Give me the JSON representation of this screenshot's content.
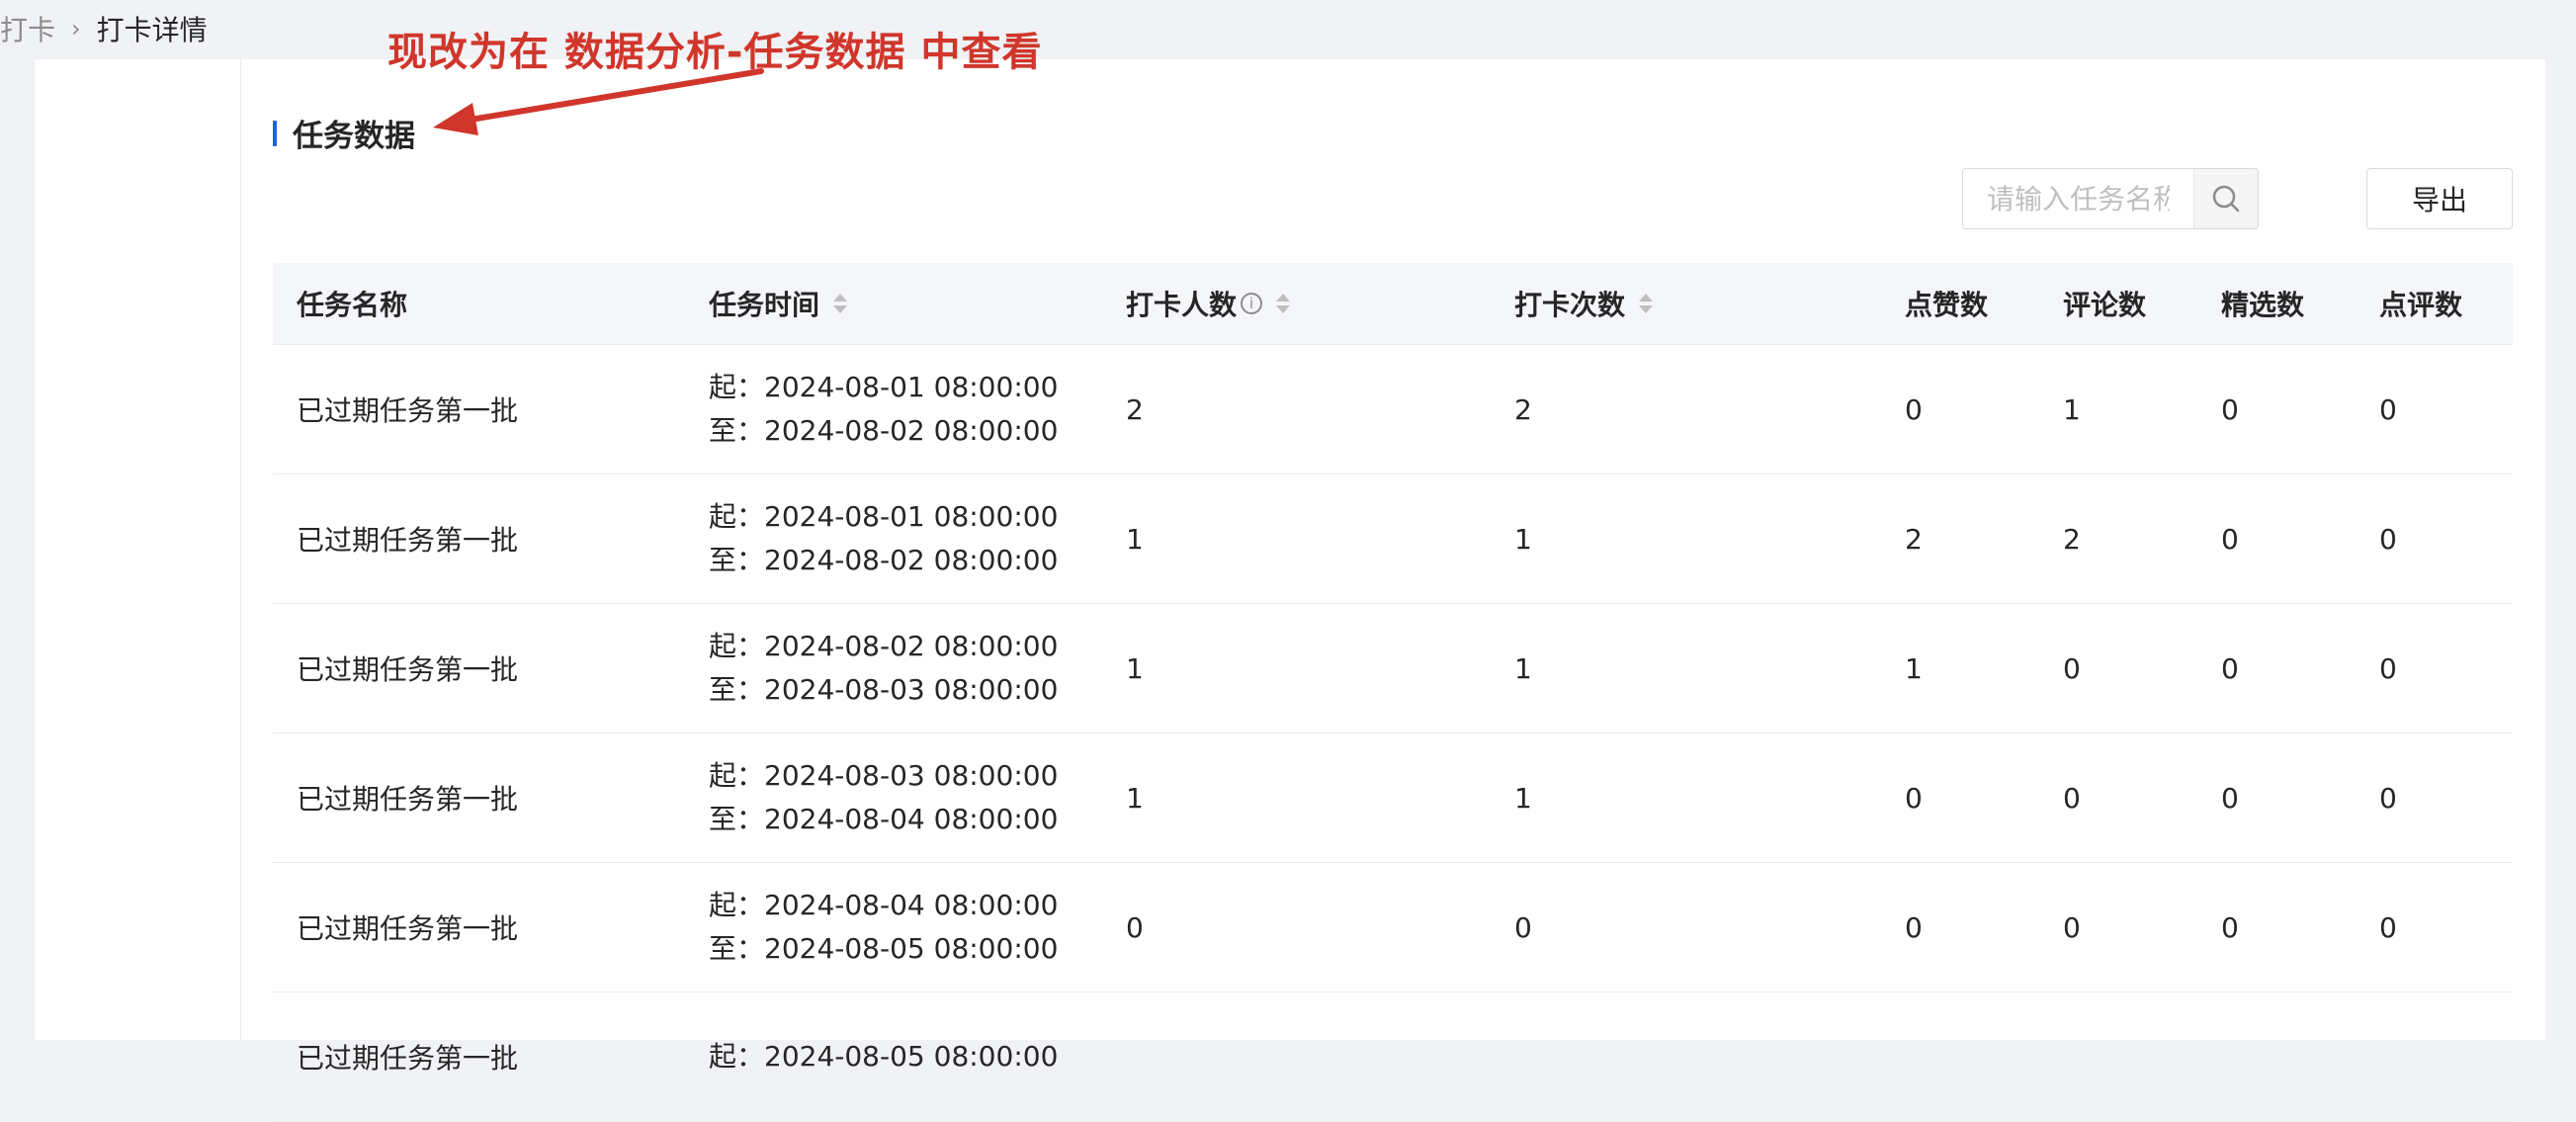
{
  "breadcrumb": {
    "items": [
      "打卡"
    ],
    "current": "打卡详情"
  },
  "annotation": {
    "text": "现改为在 数据分析-任务数据 中查看"
  },
  "section": {
    "title": "任务数据"
  },
  "search": {
    "placeholder": "请输入任务名称",
    "value": ""
  },
  "toolbar": {
    "export_label": "导出"
  },
  "table": {
    "headers": [
      "任务名称",
      "任务时间",
      "打卡人数",
      "打卡次数",
      "点赞数",
      "评论数",
      "精选数",
      "点评数"
    ],
    "rows": [
      {
        "name": "已过期任务第一批",
        "start": "起：2024-08-01 08:00:00",
        "end": "至：2024-08-02 08:00:00",
        "checkin_people": "2",
        "checkin_times": "2",
        "likes": "0",
        "comments": "1",
        "featured": "0",
        "reviews": "0"
      },
      {
        "name": "已过期任务第一批",
        "start": "起：2024-08-01 08:00:00",
        "end": "至：2024-08-02 08:00:00",
        "checkin_people": "1",
        "checkin_times": "1",
        "likes": "2",
        "comments": "2",
        "featured": "0",
        "reviews": "0"
      },
      {
        "name": "已过期任务第一批",
        "start": "起：2024-08-02 08:00:00",
        "end": "至：2024-08-03 08:00:00",
        "checkin_people": "1",
        "checkin_times": "1",
        "likes": "1",
        "comments": "0",
        "featured": "0",
        "reviews": "0"
      },
      {
        "name": "已过期任务第一批",
        "start": "起：2024-08-03 08:00:00",
        "end": "至：2024-08-04 08:00:00",
        "checkin_people": "1",
        "checkin_times": "1",
        "likes": "0",
        "comments": "0",
        "featured": "0",
        "reviews": "0"
      },
      {
        "name": "已过期任务第一批",
        "start": "起：2024-08-04 08:00:00",
        "end": "至：2024-08-05 08:00:00",
        "checkin_people": "0",
        "checkin_times": "0",
        "likes": "0",
        "comments": "0",
        "featured": "0",
        "reviews": "0"
      },
      {
        "name": "已过期任务第一批",
        "start": "起：2024-08-05 08:00:00",
        "end": "",
        "checkin_people": "",
        "checkin_times": "",
        "likes": "",
        "comments": "",
        "featured": "",
        "reviews": ""
      }
    ]
  },
  "colors": {
    "accent": "#1f5fe0",
    "annotation": "#d0362b",
    "header_bg": "#f5f6fa"
  },
  "icons": {
    "search": "search-icon",
    "info": "info-icon",
    "sort": "sort-icon",
    "separator": "chevron-right-icon"
  }
}
